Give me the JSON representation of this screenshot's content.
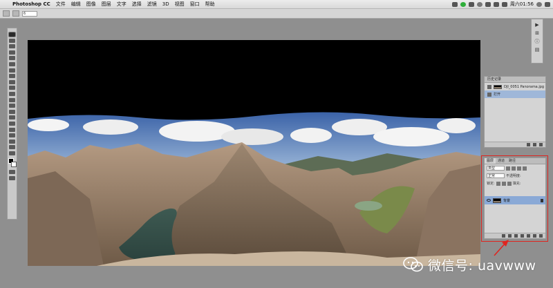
{
  "menubar": {
    "app_name": "Photoshop CC",
    "items": [
      "文件",
      "编辑",
      "图像",
      "图层",
      "文字",
      "选择",
      "滤镜",
      "3D",
      "视图",
      "窗口",
      "帮助"
    ],
    "clock": "周六01:56"
  },
  "optionsbar": {
    "field_value": "6"
  },
  "history_panel": {
    "tab": "历史记录",
    "snapshot": "DJI_0051 Panorama.jpg",
    "step": "打开"
  },
  "layers_panel": {
    "tabs": [
      "图层",
      "通道",
      "路径"
    ],
    "kind_filter": "类型",
    "blend_mode": "正常",
    "opacity_label": "不透明度:",
    "lock_label": "锁定:",
    "fill_label": "填充:",
    "layer_name": "背景"
  },
  "watermark": {
    "text": "微信号: uavwww"
  },
  "colors": {
    "highlight": "#e0241f",
    "selection": "#8aa9d6"
  }
}
